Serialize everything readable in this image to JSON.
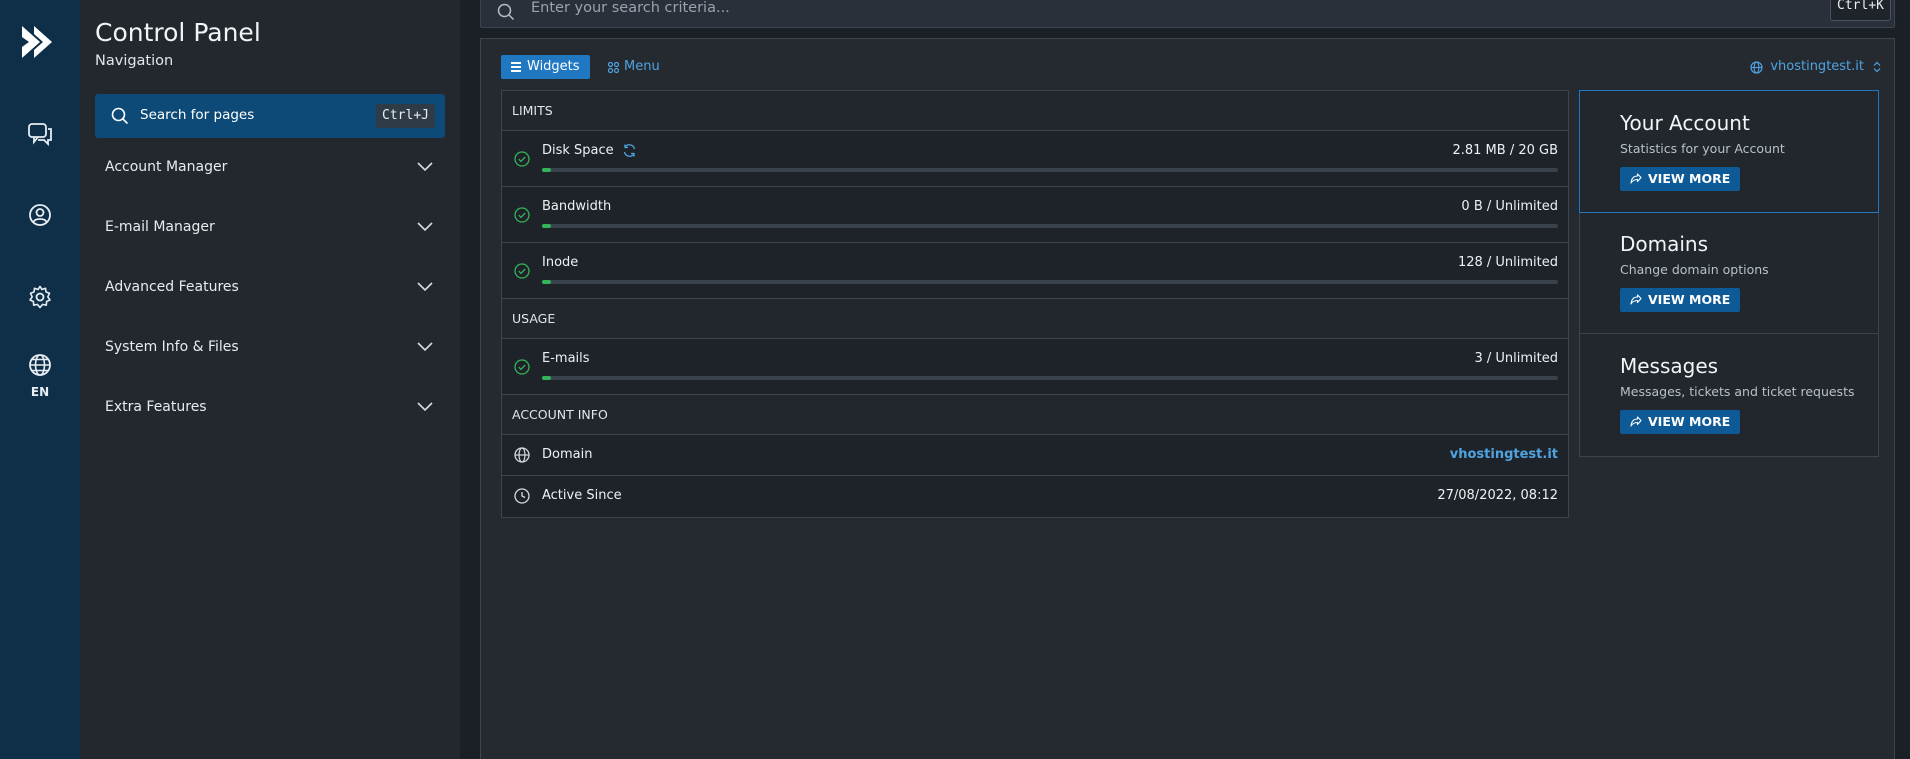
{
  "rail": {
    "icons": [
      "logo-icon",
      "chat-icon",
      "user-icon",
      "gear-icon",
      "globe-icon"
    ],
    "lang": "EN"
  },
  "nav": {
    "title": "Control Panel",
    "subtitle": "Navigation",
    "search_label": "Search for pages",
    "search_shortcut": "Ctrl+J",
    "items": [
      {
        "label": "Account Manager"
      },
      {
        "label": "E-mail Manager"
      },
      {
        "label": "Advanced Features"
      },
      {
        "label": "System Info & Files"
      },
      {
        "label": "Extra Features"
      }
    ]
  },
  "topsearch": {
    "placeholder": "Enter your search criteria...",
    "shortcut": "Ctrl+K"
  },
  "main": {
    "tab_widgets": "Widgets",
    "tab_menu": "Menu",
    "domain": "vhostingtest.it",
    "limits": {
      "section": "LIMITS",
      "rows": [
        {
          "name": "Disk Space",
          "value": "2.81 MB / 20 GB",
          "fill_fraction": 0.0001
        },
        {
          "name": "Bandwidth",
          "value": "0 B / Unlimited",
          "fill_fraction": 0
        },
        {
          "name": "Inode",
          "value": "128 / Unlimited",
          "fill_fraction": 0
        }
      ]
    },
    "usage": {
      "section": "USAGE",
      "rows": [
        {
          "name": "E-mails",
          "value": "3 / Unlimited",
          "fill_fraction": 0
        }
      ]
    },
    "account_info": {
      "section": "ACCOUNT INFO",
      "domain_label": "Domain",
      "domain_value": "vhostingtest.it",
      "since_label": "Active Since",
      "since_value": "27/08/2022, 08:12"
    },
    "cards": [
      {
        "title": "Your Account",
        "desc": "Statistics for your Account",
        "button": "VIEW MORE"
      },
      {
        "title": "Domains",
        "desc": "Change domain options",
        "button": "VIEW MORE"
      },
      {
        "title": "Messages",
        "desc": "Messages, tickets and ticket requests",
        "button": "VIEW MORE"
      }
    ]
  },
  "colors": {
    "accent": "#1f78c1",
    "link": "#4fa3e0",
    "ok": "#33b35a",
    "rail": "#0f2e48"
  }
}
